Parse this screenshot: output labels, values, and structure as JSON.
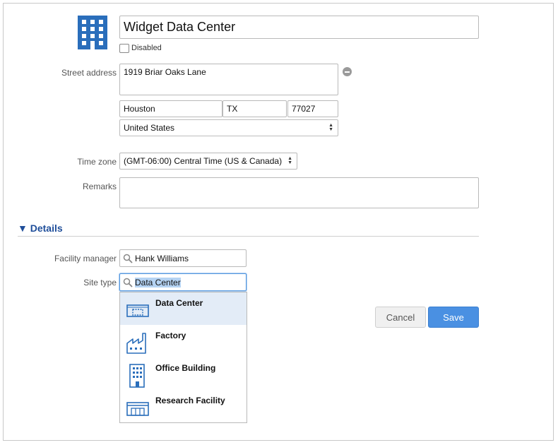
{
  "header": {
    "name_value": "Widget Data Center",
    "disabled_label": "Disabled"
  },
  "address": {
    "label": "Street address",
    "street": "1919 Briar Oaks Lane",
    "city": "Houston",
    "state": "TX",
    "zip": "77027",
    "country": "United States"
  },
  "timezone": {
    "label": "Time zone",
    "value": "(GMT-06:00) Central Time (US & Canada)"
  },
  "remarks": {
    "label": "Remarks",
    "value": ""
  },
  "details": {
    "toggle": "▼",
    "title": "Details",
    "facility_manager_label": "Facility manager",
    "facility_manager_value": "Hank Williams",
    "site_type_label": "Site type",
    "site_type_value": "Data Center",
    "site_type_options": [
      {
        "label": "Data Center",
        "icon": "data-center-icon"
      },
      {
        "label": "Factory",
        "icon": "factory-icon"
      },
      {
        "label": "Office Building",
        "icon": "office-building-icon"
      },
      {
        "label": "Research Facility",
        "icon": "research-facility-icon"
      }
    ]
  },
  "actions": {
    "cancel_label": "Cancel",
    "save_label": "Save"
  },
  "colors": {
    "accent": "#2a6ebb",
    "save_button": "#4a90e2",
    "details_heading": "#1f4e9a",
    "dropdown_highlight": "#e3ecf7"
  }
}
